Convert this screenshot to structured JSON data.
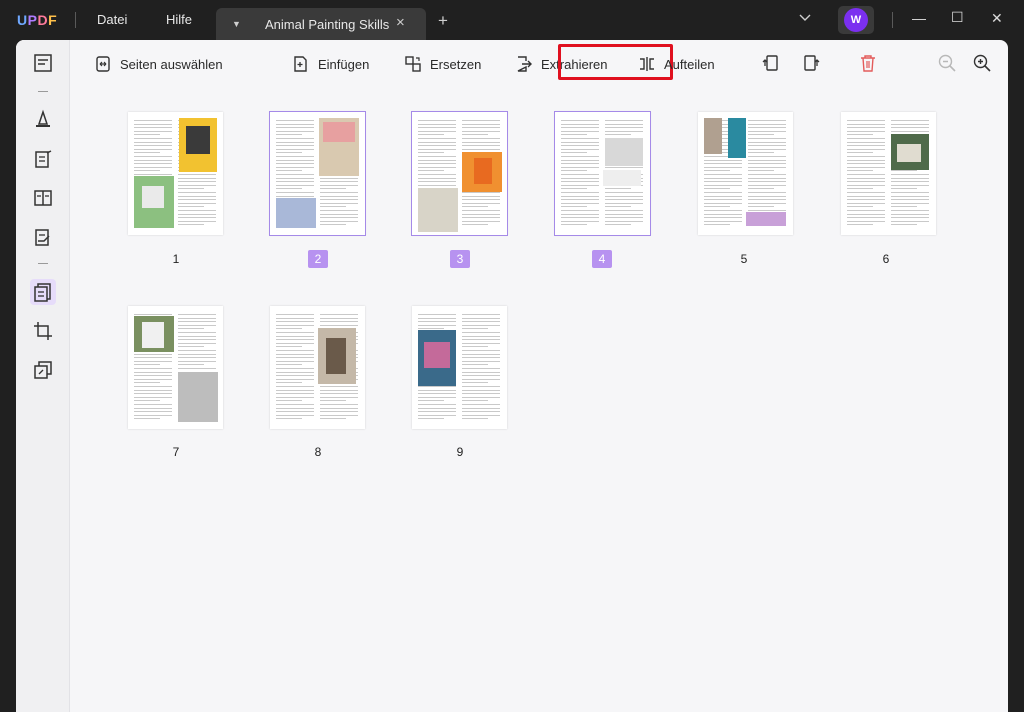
{
  "app": {
    "logo": [
      "U",
      "P",
      "D",
      "F"
    ],
    "menu": [
      "Datei",
      "Hilfe"
    ],
    "tab_title": "Animal Painting Skills",
    "tab_close": "×",
    "new_tab": "+",
    "avatar_initial": "W",
    "window_controls": [
      "—",
      "☐",
      "✕"
    ]
  },
  "toolbar": {
    "select_pages": "Seiten auswählen",
    "insert": "Einfügen",
    "replace": "Ersetzen",
    "extract": "Extrahieren",
    "split": "Aufteilen"
  },
  "pages": [
    {
      "number": "1",
      "selected": false
    },
    {
      "number": "2",
      "selected": true
    },
    {
      "number": "3",
      "selected": true
    },
    {
      "number": "4",
      "selected": true
    },
    {
      "number": "5",
      "selected": false
    },
    {
      "number": "6",
      "selected": false
    },
    {
      "number": "7",
      "selected": false
    },
    {
      "number": "8",
      "selected": false
    },
    {
      "number": "9",
      "selected": false
    }
  ],
  "colors": {
    "accent": "#b792f0",
    "highlight": "#e0101f",
    "delete": "#e35b5b"
  }
}
